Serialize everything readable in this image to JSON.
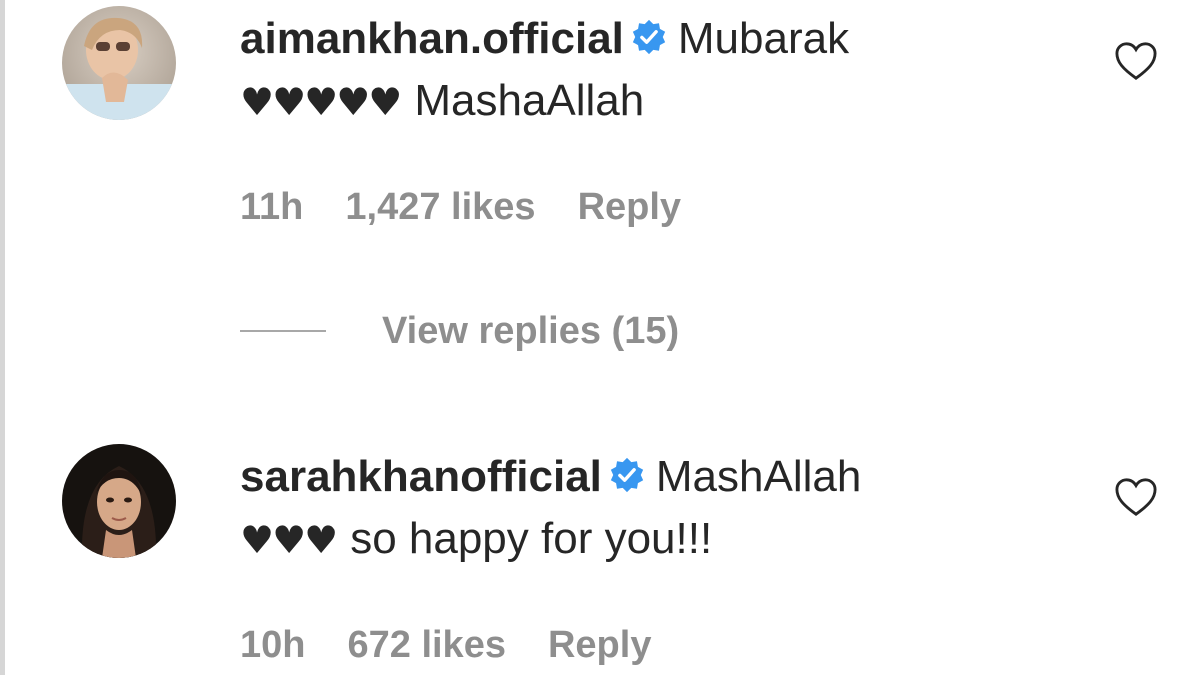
{
  "comments": [
    {
      "username": "aimankhan.official",
      "hearts": "♥♥♥♥♥",
      "text_before_hearts": "Mubarak",
      "text_after_hearts": "MashaAllah",
      "time": "11h",
      "likes": "1,427 likes",
      "reply_label": "Reply",
      "view_replies": "View replies (15)"
    },
    {
      "username": "sarahkhanofficial",
      "hearts": "♥♥♥",
      "text_before_hearts": "MashAllah",
      "text_after_hearts": "so happy for you!!!",
      "time": "10h",
      "likes": "672 likes",
      "reply_label": "Reply"
    }
  ],
  "colors": {
    "text_primary": "#262626",
    "text_secondary": "#8e8e8e",
    "verified_blue": "#3897f0"
  },
  "icons": {
    "verified": "verified-badge-icon",
    "like": "heart-outline-icon"
  }
}
